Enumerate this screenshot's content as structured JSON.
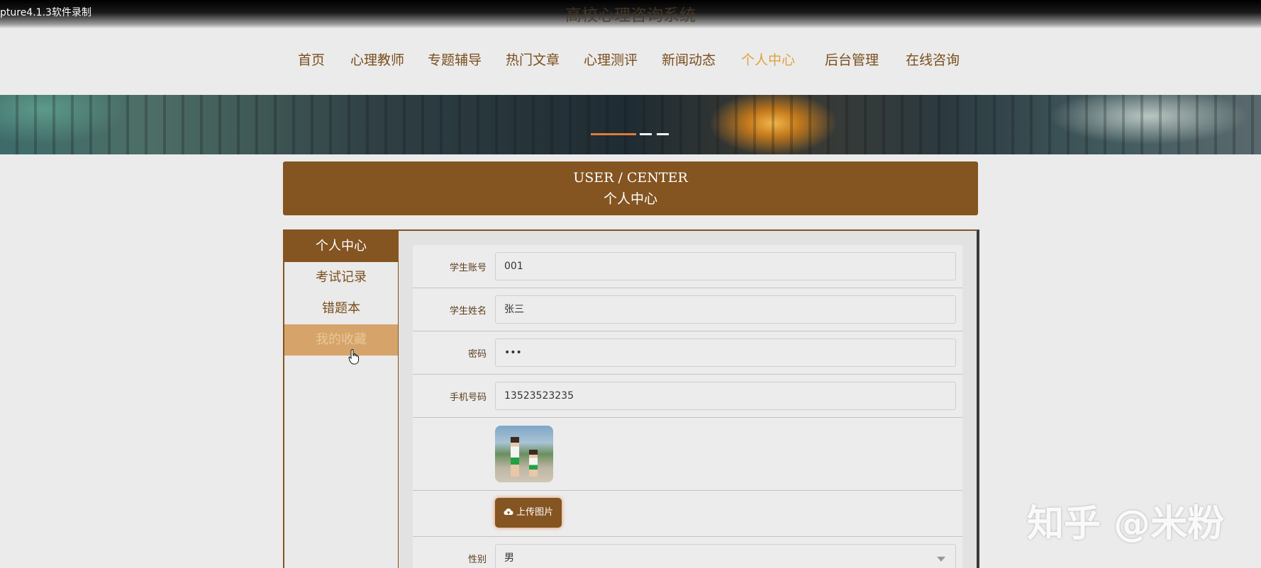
{
  "recorder": {
    "label": "pture4.1.3软件录制"
  },
  "site": {
    "title": "高校心理咨询系统"
  },
  "nav": {
    "items": [
      {
        "label": "首页"
      },
      {
        "label": "心理教师"
      },
      {
        "label": "专题辅导"
      },
      {
        "label": "热门文章"
      },
      {
        "label": "心理测评"
      },
      {
        "label": "新闻动态"
      },
      {
        "label": "个人中心"
      },
      {
        "label": "后台管理"
      },
      {
        "label": "在线咨询"
      }
    ],
    "active": "个人中心"
  },
  "banner": {
    "slide_count": 3,
    "active_slide": 1
  },
  "header": {
    "title_en": "USER / CENTER",
    "title_cn": "个人中心"
  },
  "sidebar": {
    "items": [
      {
        "label": "个人中心",
        "state": "active"
      },
      {
        "label": "考试记录",
        "state": "normal"
      },
      {
        "label": "错题本",
        "state": "normal"
      },
      {
        "label": "我的收藏",
        "state": "hover"
      }
    ]
  },
  "form": {
    "account": {
      "label": "学生账号",
      "value": "001"
    },
    "name": {
      "label": "学生姓名",
      "value": "张三"
    },
    "password": {
      "label": "密码",
      "value": "•••"
    },
    "phone": {
      "label": "手机号码",
      "value": "13523523235"
    },
    "avatar": {
      "icon": "avatar-photo"
    },
    "upload": {
      "label": "上传图片",
      "icon": "cloud-upload-icon"
    },
    "gender": {
      "label": "性别",
      "value": "男"
    }
  },
  "watermark": {
    "text": "知乎 @米粉"
  },
  "colors": {
    "brand": "#845421",
    "accent": "#e0a13c",
    "hover": "#d6a46a"
  }
}
